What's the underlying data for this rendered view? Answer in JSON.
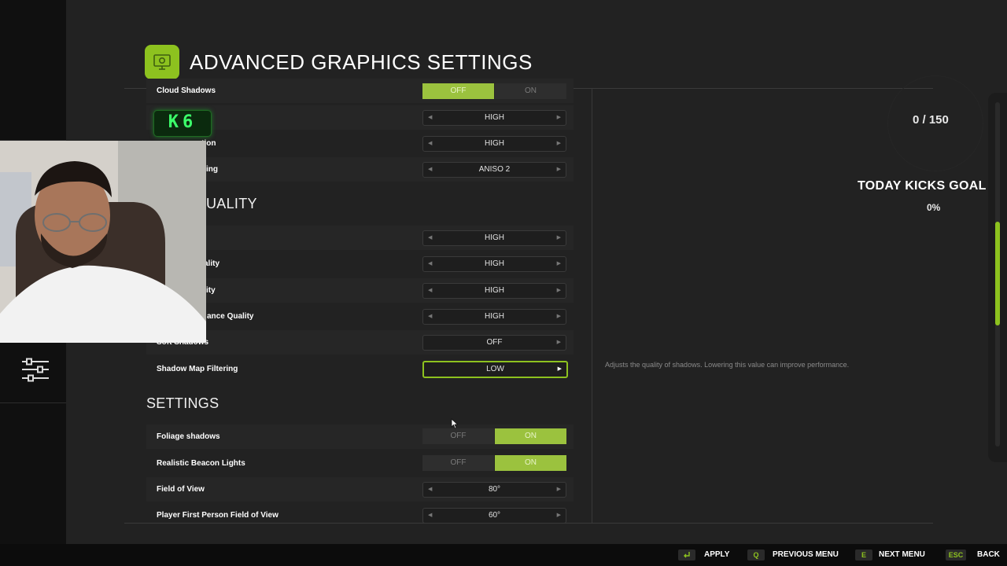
{
  "header": {
    "title": "ADVANCED GRAPHICS SETTINGS",
    "icon": "monitor-settings-icon"
  },
  "colors": {
    "accent": "#8dc21f",
    "toggle_on": "#9bc23e",
    "background": "#222222"
  },
  "rows_top": [
    {
      "label": "Cloud Shadows",
      "type": "toggle",
      "off": "OFF",
      "on": "ON",
      "value": "OFF"
    },
    {
      "label": "",
      "type": "selector",
      "value": "HIGH"
    },
    {
      "label": "ution",
      "type": "selector",
      "value": "HIGH"
    },
    {
      "label": "ing",
      "type": "selector",
      "value": "ANISO 2"
    }
  ],
  "section_quality": {
    "title": "UALITY"
  },
  "rows_quality": [
    {
      "label": "",
      "type": "selector",
      "value": "HIGH"
    },
    {
      "label": "ality",
      "type": "selector",
      "value": "HIGH"
    },
    {
      "label": "ity",
      "type": "selector",
      "value": "HIGH"
    },
    {
      "label": "ance Quality",
      "type": "selector",
      "value": "HIGH"
    },
    {
      "label": "Soft Shadows",
      "type": "selector",
      "value": "OFF"
    },
    {
      "label": "Shadow Map Filtering",
      "type": "selector",
      "value": "LOW",
      "focused": true
    }
  ],
  "section_settings": {
    "title": "SETTINGS"
  },
  "rows_settings": [
    {
      "label": "Foliage shadows",
      "type": "toggle",
      "off": "OFF",
      "on": "ON",
      "value": "ON"
    },
    {
      "label": "Realistic Beacon Lights",
      "type": "toggle",
      "off": "OFF",
      "on": "ON",
      "value": "ON"
    },
    {
      "label": "Field of View",
      "type": "selector",
      "value": "80°"
    },
    {
      "label": "Player First Person Field of View",
      "type": "selector",
      "value": "60°"
    }
  ],
  "description": "Adjusts the quality of shadows. Lowering this value can improve performance.",
  "overlay": {
    "counter": "0 / 150",
    "goal_title": "TODAY KICKS GOAL",
    "goal_percent": "0%",
    "badge": "K6",
    "goal_bar_fraction": 0.3
  },
  "footer": {
    "apply": {
      "key": "",
      "label": "APPLY"
    },
    "previous": {
      "key": "Q",
      "label": "PREVIOUS MENU"
    },
    "next": {
      "key": "E",
      "label": "NEXT MENU"
    },
    "back": {
      "key": "ESC",
      "label": "BACK"
    }
  }
}
